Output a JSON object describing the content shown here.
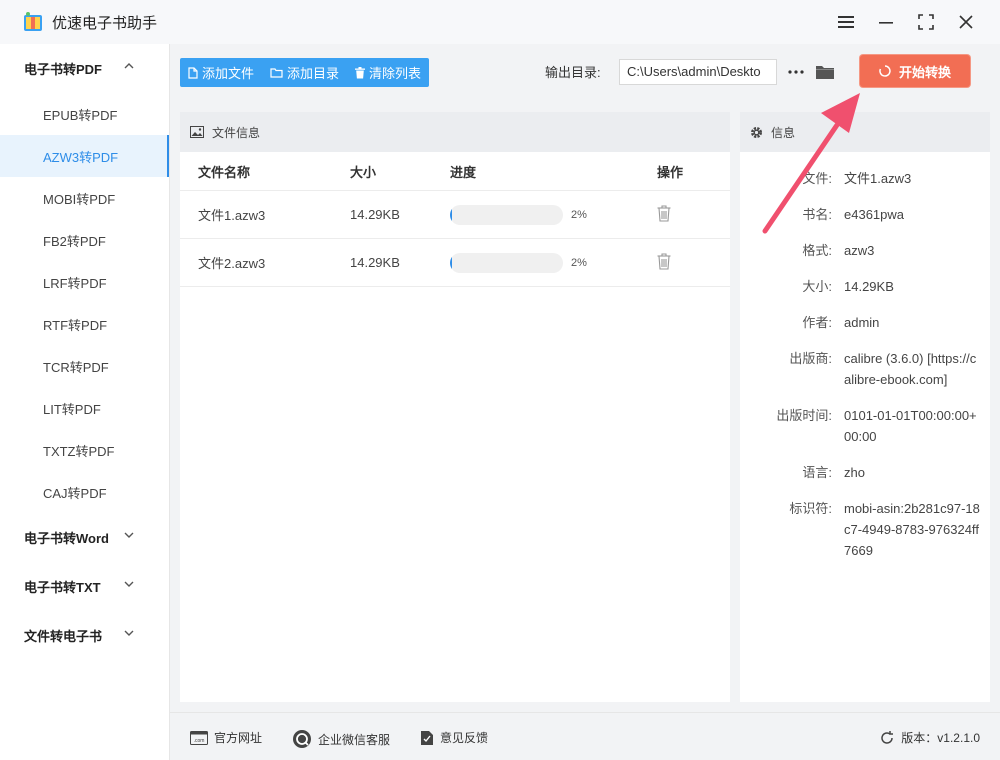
{
  "app": {
    "title": "优速电子书助手"
  },
  "sidebar": {
    "groups": [
      {
        "label": "电子书转PDF",
        "items": [
          "EPUB转PDF",
          "AZW3转PDF",
          "MOBI转PDF",
          "FB2转PDF",
          "LRF转PDF",
          "RTF转PDF",
          "TCR转PDF",
          "LIT转PDF",
          "TXTZ转PDF",
          "CAJ转PDF"
        ]
      },
      {
        "label": "电子书转Word"
      },
      {
        "label": "电子书转TXT"
      },
      {
        "label": "文件转电子书"
      }
    ]
  },
  "toolbar": {
    "add_file": "添加文件",
    "add_dir": "添加目录",
    "clear_list": "清除列表",
    "output_label": "输出目录:",
    "output_path": "C:\\Users\\admin\\Deskto",
    "start": "开始转换"
  },
  "file_panel": {
    "title": "文件信息",
    "columns": [
      "文件名称",
      "大小",
      "进度",
      "操作"
    ],
    "rows": [
      {
        "name": "文件1.azw3",
        "size": "14.29KB",
        "progress": 2,
        "progress_text": "2%"
      },
      {
        "name": "文件2.azw3",
        "size": "14.29KB",
        "progress": 2,
        "progress_text": "2%"
      }
    ]
  },
  "info_panel": {
    "title": "信息",
    "fields": [
      {
        "k": "文件:",
        "v": "文件1.azw3"
      },
      {
        "k": "书名:",
        "v": "e4361pwa"
      },
      {
        "k": "格式:",
        "v": "azw3"
      },
      {
        "k": "大小:",
        "v": "14.29KB"
      },
      {
        "k": "作者:",
        "v": "admin"
      },
      {
        "k": "出版商:",
        "v": "calibre (3.6.0) [https://calibre-ebook.com]"
      },
      {
        "k": "出版时间:",
        "v": "0101-01-01T00:00:00+00:00"
      },
      {
        "k": "语言:",
        "v": "zho"
      },
      {
        "k": "标识符:",
        "v": "mobi-asin:2b281c97-18c7-4949-8783-976324ff7669"
      }
    ]
  },
  "footer": {
    "website": "官方网址",
    "wechat": "企业微信客服",
    "feedback": "意见反馈",
    "version": "版本：v1.2.1.0"
  },
  "colors": {
    "accent": "#2e8de8",
    "toolbar_btn": "#3aa1f2",
    "start": "#f26e54",
    "arrow": "#f0506e"
  },
  "icons": [
    "app-logo-icon",
    "menu-icon",
    "minimize-icon",
    "maximize-icon",
    "close-icon",
    "file-icon",
    "folder-icon",
    "trash-icon",
    "image-icon",
    "gear-icon",
    "spinner-icon",
    "web-icon",
    "chat-icon",
    "feedback-icon",
    "refresh-icon"
  ]
}
